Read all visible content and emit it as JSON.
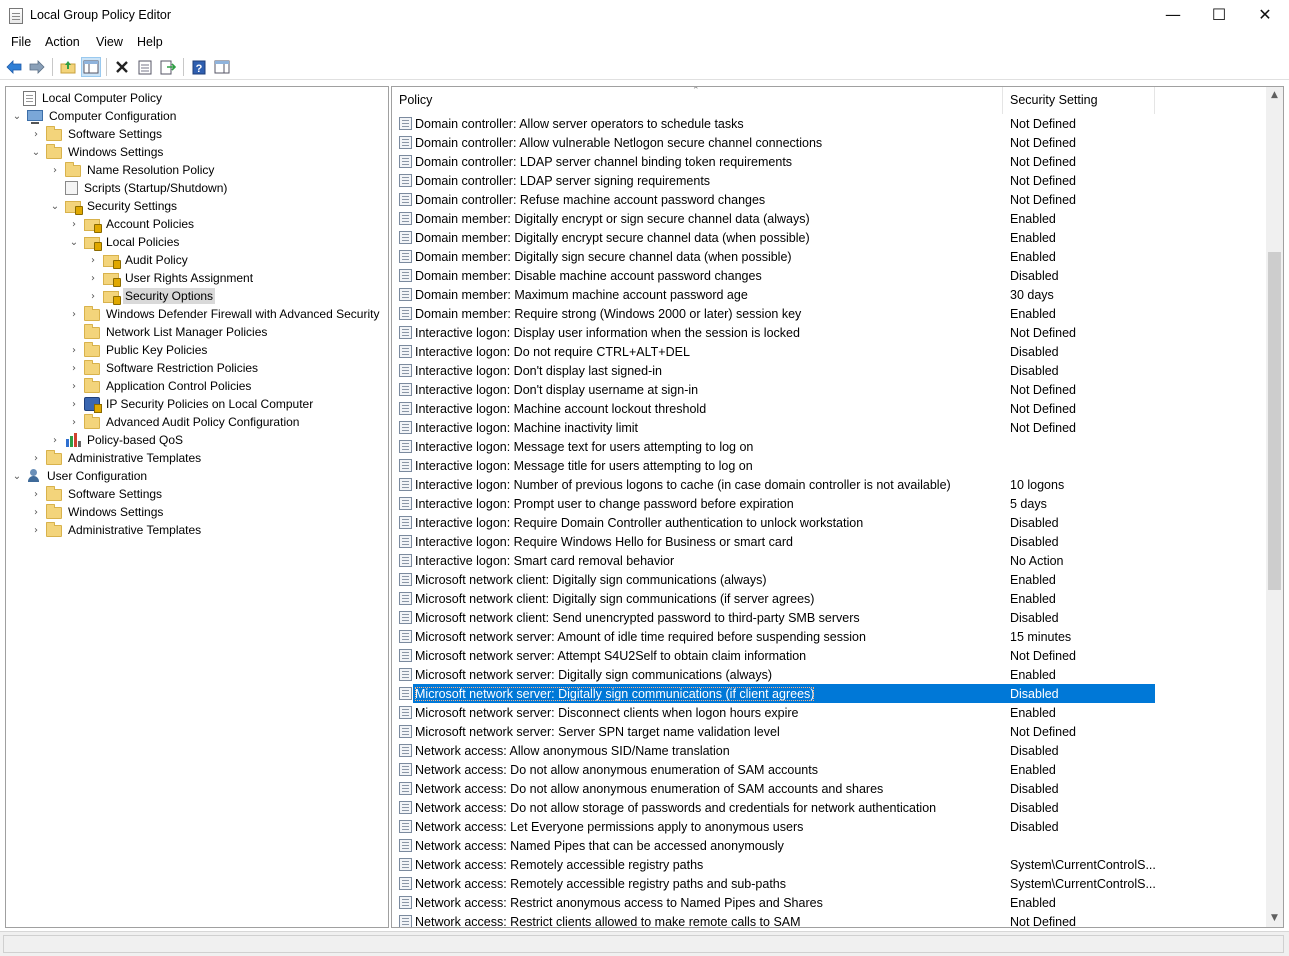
{
  "window": {
    "title": "Local Group Policy Editor",
    "minimize_glyph": "—",
    "maximize_glyph": "☐",
    "close_glyph": "✕"
  },
  "menu": [
    "File",
    "Action",
    "View",
    "Help"
  ],
  "toolbar": {
    "icons": [
      "back-arrow-icon",
      "forward-arrow-icon",
      "up-folder-icon",
      "show-hide-tree-icon",
      "delete-icon",
      "properties-icon",
      "export-list-icon",
      "help-icon",
      "show-hide-action-pane-icon"
    ]
  },
  "tree": {
    "root": "Local Computer Policy",
    "computer_configuration": "Computer Configuration",
    "cc_software_settings": "Software Settings",
    "cc_windows_settings": "Windows Settings",
    "name_resolution_policy": "Name Resolution Policy",
    "scripts": "Scripts (Startup/Shutdown)",
    "security_settings": "Security Settings",
    "account_policies": "Account Policies",
    "local_policies": "Local Policies",
    "audit_policy": "Audit Policy",
    "user_rights_assignment": "User Rights Assignment",
    "security_options": "Security Options",
    "windows_defender_firewall": "Windows Defender Firewall with Advanced Security",
    "network_list_manager": "Network List Manager Policies",
    "public_key_policies": "Public Key Policies",
    "software_restriction_policies": "Software Restriction Policies",
    "application_control_policies": "Application Control Policies",
    "ip_security_policies": "IP Security Policies on Local Computer",
    "advanced_audit_policy": "Advanced Audit Policy Configuration",
    "policy_based_qos": "Policy-based QoS",
    "cc_administrative_templates": "Administrative Templates",
    "user_configuration": "User Configuration",
    "uc_software_settings": "Software Settings",
    "uc_windows_settings": "Windows Settings",
    "uc_administrative_templates": "Administrative Templates"
  },
  "list": {
    "col_policy": "Policy",
    "col_setting": "Security Setting",
    "rows": [
      {
        "policy": "Domain controller: Allow server operators to schedule tasks",
        "setting": "Not Defined"
      },
      {
        "policy": "Domain controller: Allow vulnerable Netlogon secure channel connections",
        "setting": "Not Defined"
      },
      {
        "policy": "Domain controller: LDAP server channel binding token requirements",
        "setting": "Not Defined"
      },
      {
        "policy": "Domain controller: LDAP server signing requirements",
        "setting": "Not Defined"
      },
      {
        "policy": "Domain controller: Refuse machine account password changes",
        "setting": "Not Defined"
      },
      {
        "policy": "Domain member: Digitally encrypt or sign secure channel data (always)",
        "setting": "Enabled"
      },
      {
        "policy": "Domain member: Digitally encrypt secure channel data (when possible)",
        "setting": "Enabled"
      },
      {
        "policy": "Domain member: Digitally sign secure channel data (when possible)",
        "setting": "Enabled"
      },
      {
        "policy": "Domain member: Disable machine account password changes",
        "setting": "Disabled"
      },
      {
        "policy": "Domain member: Maximum machine account password age",
        "setting": "30 days"
      },
      {
        "policy": "Domain member: Require strong (Windows 2000 or later) session key",
        "setting": "Enabled"
      },
      {
        "policy": "Interactive logon: Display user information when the session is locked",
        "setting": "Not Defined"
      },
      {
        "policy": "Interactive logon: Do not require CTRL+ALT+DEL",
        "setting": "Disabled"
      },
      {
        "policy": "Interactive logon: Don't display last signed-in",
        "setting": "Disabled"
      },
      {
        "policy": "Interactive logon: Don't display username at sign-in",
        "setting": "Not Defined"
      },
      {
        "policy": "Interactive logon: Machine account lockout threshold",
        "setting": "Not Defined"
      },
      {
        "policy": "Interactive logon: Machine inactivity limit",
        "setting": "Not Defined"
      },
      {
        "policy": "Interactive logon: Message text for users attempting to log on",
        "setting": ""
      },
      {
        "policy": "Interactive logon: Message title for users attempting to log on",
        "setting": ""
      },
      {
        "policy": "Interactive logon: Number of previous logons to cache (in case domain controller is not available)",
        "setting": "10 logons"
      },
      {
        "policy": "Interactive logon: Prompt user to change password before expiration",
        "setting": "5 days"
      },
      {
        "policy": "Interactive logon: Require Domain Controller authentication to unlock workstation",
        "setting": "Disabled"
      },
      {
        "policy": "Interactive logon: Require Windows Hello for Business or smart card",
        "setting": "Disabled"
      },
      {
        "policy": "Interactive logon: Smart card removal behavior",
        "setting": "No Action"
      },
      {
        "policy": "Microsoft network client: Digitally sign communications (always)",
        "setting": "Enabled"
      },
      {
        "policy": "Microsoft network client: Digitally sign communications (if server agrees)",
        "setting": "Enabled"
      },
      {
        "policy": "Microsoft network client: Send unencrypted password to third-party SMB servers",
        "setting": "Disabled"
      },
      {
        "policy": "Microsoft network server: Amount of idle time required before suspending session",
        "setting": "15 minutes"
      },
      {
        "policy": "Microsoft network server: Attempt S4U2Self to obtain claim information",
        "setting": "Not Defined"
      },
      {
        "policy": "Microsoft network server: Digitally sign communications (always)",
        "setting": "Enabled"
      },
      {
        "policy": "Microsoft network server: Digitally sign communications (if client agrees)",
        "setting": "Disabled"
      },
      {
        "policy": "Microsoft network server: Disconnect clients when logon hours expire",
        "setting": "Enabled"
      },
      {
        "policy": "Microsoft network server: Server SPN target name validation level",
        "setting": "Not Defined"
      },
      {
        "policy": "Network access: Allow anonymous SID/Name translation",
        "setting": "Disabled"
      },
      {
        "policy": "Network access: Do not allow anonymous enumeration of SAM accounts",
        "setting": "Enabled"
      },
      {
        "policy": "Network access: Do not allow anonymous enumeration of SAM accounts and shares",
        "setting": "Disabled"
      },
      {
        "policy": "Network access: Do not allow storage of passwords and credentials for network authentication",
        "setting": "Disabled"
      },
      {
        "policy": "Network access: Let Everyone permissions apply to anonymous users",
        "setting": "Disabled"
      },
      {
        "policy": "Network access: Named Pipes that can be accessed anonymously",
        "setting": ""
      },
      {
        "policy": "Network access: Remotely accessible registry paths",
        "setting": "System\\CurrentControlS..."
      },
      {
        "policy": "Network access: Remotely accessible registry paths and sub-paths",
        "setting": "System\\CurrentControlS..."
      },
      {
        "policy": "Network access: Restrict anonymous access to Named Pipes and Shares",
        "setting": "Enabled"
      },
      {
        "policy": "Network access: Restrict clients allowed to make remote calls to SAM",
        "setting": "Not Defined"
      }
    ],
    "selected_index": 30
  },
  "scrollbar": {
    "up_glyph": "▲",
    "down_glyph": "▼"
  },
  "colors": {
    "selection": "#0078d7",
    "tree_selection": "#d9d9d9"
  }
}
